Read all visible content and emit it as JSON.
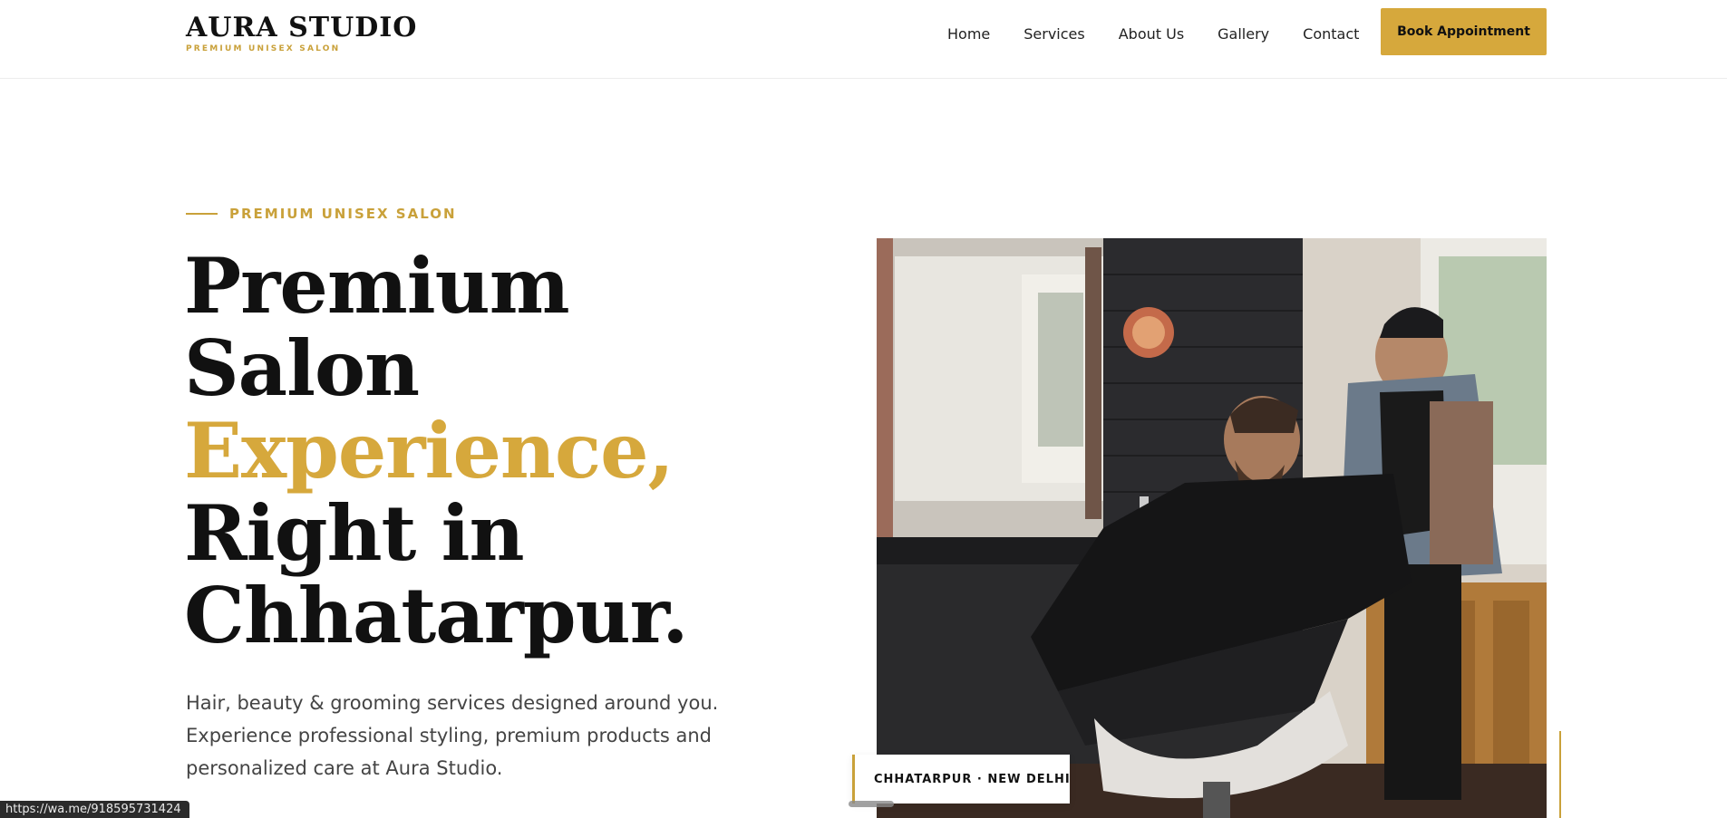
{
  "brand": {
    "title": "AURA STUDIO",
    "subtitle": "PREMIUM UNISEX SALON"
  },
  "nav": {
    "items": [
      {
        "label": "Home"
      },
      {
        "label": "Services"
      },
      {
        "label": "About Us"
      },
      {
        "label": "Gallery"
      },
      {
        "label": "Contact"
      }
    ],
    "cta": "Book Appointment"
  },
  "hero": {
    "eyebrow": "PREMIUM UNISEX SALON",
    "headline": {
      "line1": "Premium",
      "line2": "Salon",
      "line3": "Experience,",
      "line4": "Right in",
      "line5": "Chhatarpur."
    },
    "description": {
      "line1": "Hair, beauty & grooming services designed around you.",
      "line2": "Experience professional styling, premium products and",
      "line3": "personalized care at Aura Studio."
    },
    "location_badge": "CHHATARPUR · NEW DELHI"
  },
  "status_bar": {
    "url": "https://wa.me/918595731424"
  },
  "colors": {
    "accent": "#d6a83c",
    "text": "#111111",
    "body_text": "#444444"
  }
}
